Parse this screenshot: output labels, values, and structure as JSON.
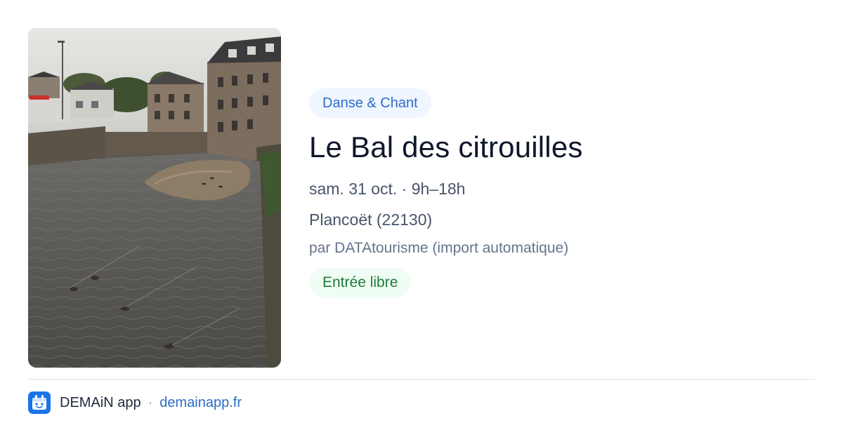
{
  "event": {
    "image_alt": "Rivière à marée basse avec canards, bâtiments en pierre",
    "category": "Danse & Chant",
    "title": "Le Bal des citrouilles",
    "date": "sam. 31 oct. · 9h–18h",
    "location": "Plancoët (22130)",
    "organizer": "par DATAtourisme (import automatique)",
    "price": "Entrée libre"
  },
  "footer": {
    "app_name": "DEMAiN app",
    "separator": "·",
    "link": "demainapp.fr"
  },
  "colors": {
    "category_bg": "#eff6ff",
    "category_text": "#2d6cc8",
    "price_bg": "#f0fdf4",
    "price_text": "#1e7a3c",
    "link": "#2d6cc8",
    "logo_blue": "#1a73e8"
  },
  "icons": {
    "app_logo": "demain-logo-icon"
  }
}
